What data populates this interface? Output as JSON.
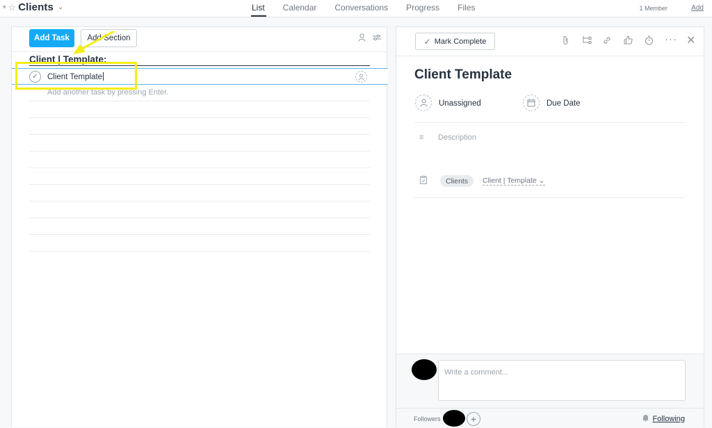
{
  "header": {
    "project_title": "Clients",
    "tabs": [
      {
        "label": "List",
        "active": true
      },
      {
        "label": "Calendar"
      },
      {
        "label": "Conversations"
      },
      {
        "label": "Progress"
      },
      {
        "label": "Files"
      }
    ],
    "members": "1 Member",
    "add": "Add"
  },
  "list": {
    "add_task": "Add Task",
    "add_section": "Add Section",
    "section": "Client | Template:",
    "task": "Client Template",
    "hint": "Add another task by pressing Enter."
  },
  "detail": {
    "mark_complete": "Mark Complete",
    "title": "Client Template",
    "assignee": "Unassigned",
    "due_date": "Due Date",
    "description_placeholder": "Description",
    "project": "Clients",
    "section": "Client | Template",
    "comment_placeholder": "Write a comment...",
    "followers_label": "Followers",
    "following": "Following"
  },
  "colors": {
    "primary": "#14aaf5",
    "highlight": "#f5ee12",
    "selected_row_border": "#5fb6e8"
  }
}
